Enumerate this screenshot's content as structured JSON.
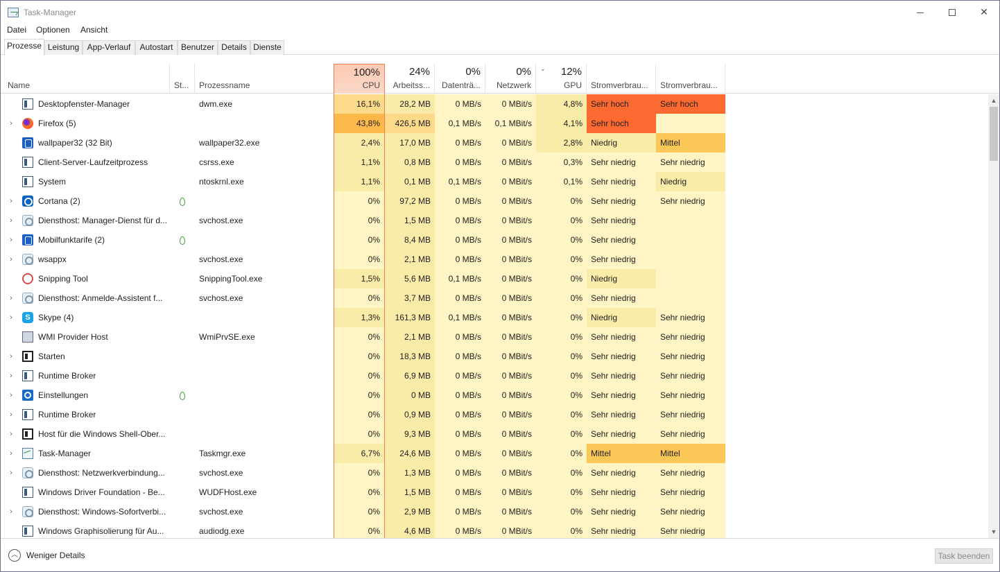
{
  "window": {
    "title": "Task-Manager",
    "minimize_glyph": "",
    "close_glyph": "✕"
  },
  "menu": [
    "Datei",
    "Optionen",
    "Ansicht"
  ],
  "tabs": [
    "Prozesse",
    "Leistung",
    "App-Verlauf",
    "Autostart",
    "Benutzer",
    "Details",
    "Dienste"
  ],
  "active_tab": "Prozesse",
  "columns": {
    "name": "Name",
    "status": "St...",
    "process": "Prozessname",
    "cpu": {
      "pct": "100%",
      "label": "CPU"
    },
    "memory": {
      "pct": "24%",
      "label": "Arbeitss..."
    },
    "disk": {
      "pct": "0%",
      "label": "Datenträ..."
    },
    "network": {
      "pct": "0%",
      "label": "Netzwerk"
    },
    "gpu": {
      "pct": "12%",
      "label": "GPU"
    },
    "power": "Stromverbrau...",
    "power_trend": "Stromverbrau...",
    "sort_glyph": "⌄"
  },
  "colors": {
    "heat_light": "#fff4c4",
    "heat_mid": "#f9eca8",
    "heat_warm": "#fdd98a",
    "heat_orange": "#fdc866",
    "heat_cpu_high": "#fcb84a",
    "power_very_high": "#fc6a32",
    "power_medium": "#fbc858",
    "cpu_accent": "#f08050"
  },
  "rows": [
    {
      "expand": "",
      "icon": "window",
      "name": "Desktopfenster-Manager",
      "leaf": false,
      "process": "dwm.exe",
      "cpu": "16,1%",
      "mem": "28,2 MB",
      "disk": "0 MB/s",
      "net": "0 MBit/s",
      "gpu": "4,8%",
      "power": "Sehr hoch",
      "power_trend": "Sehr hoch",
      "cpu_lvl": "warm",
      "gpu_lvl": "mid",
      "pow_lvl": "very_high",
      "powt_lvl": "very_high"
    },
    {
      "expand": "›",
      "icon": "firefox",
      "name": "Firefox (5)",
      "leaf": false,
      "process": "",
      "cpu": "43,8%",
      "mem": "426,5 MB",
      "disk": "0,1 MB/s",
      "net": "0,1 MBit/s",
      "gpu": "4,1%",
      "power": "Sehr hoch",
      "power_trend": "",
      "cpu_lvl": "cpu_high",
      "gpu_lvl": "mid",
      "pow_lvl": "very_high",
      "powt_lvl": "light"
    },
    {
      "expand": "",
      "icon": "blue",
      "name": "wallpaper32 (32 Bit)",
      "leaf": false,
      "process": "wallpaper32.exe",
      "cpu": "2,4%",
      "mem": "17,0 MB",
      "disk": "0 MB/s",
      "net": "0 MBit/s",
      "gpu": "2,8%",
      "power": "Niedrig",
      "power_trend": "Mittel",
      "cpu_lvl": "mid",
      "gpu_lvl": "mid",
      "pow_lvl": "mid",
      "powt_lvl": "medium"
    },
    {
      "expand": "",
      "icon": "window",
      "name": "Client-Server-Laufzeitprozess",
      "leaf": false,
      "process": "csrss.exe",
      "cpu": "1,1%",
      "mem": "0,8 MB",
      "disk": "0 MB/s",
      "net": "0 MBit/s",
      "gpu": "0,3%",
      "power": "Sehr niedrig",
      "power_trend": "Sehr niedrig",
      "cpu_lvl": "mid",
      "gpu_lvl": "light",
      "pow_lvl": "light",
      "powt_lvl": "light"
    },
    {
      "expand": "",
      "icon": "window",
      "name": "System",
      "leaf": false,
      "process": "ntoskrnl.exe",
      "cpu": "1,1%",
      "mem": "0,1 MB",
      "disk": "0,1 MB/s",
      "net": "0 MBit/s",
      "gpu": "0,1%",
      "power": "Sehr niedrig",
      "power_trend": "Niedrig",
      "cpu_lvl": "mid",
      "gpu_lvl": "light",
      "pow_lvl": "light",
      "powt_lvl": "mid"
    },
    {
      "expand": "›",
      "icon": "cortana",
      "name": "Cortana (2)",
      "leaf": true,
      "process": "",
      "cpu": "0%",
      "mem": "97,2 MB",
      "disk": "0 MB/s",
      "net": "0 MBit/s",
      "gpu": "0%",
      "power": "Sehr niedrig",
      "power_trend": "Sehr niedrig",
      "cpu_lvl": "light",
      "gpu_lvl": "light",
      "pow_lvl": "light",
      "powt_lvl": "light"
    },
    {
      "expand": "›",
      "icon": "gear",
      "name": "Diensthost: Manager-Dienst für d...",
      "leaf": false,
      "process": "svchost.exe",
      "cpu": "0%",
      "mem": "1,5 MB",
      "disk": "0 MB/s",
      "net": "0 MBit/s",
      "gpu": "0%",
      "power": "Sehr niedrig",
      "power_trend": "",
      "cpu_lvl": "light",
      "gpu_lvl": "light",
      "pow_lvl": "light",
      "powt_lvl": "light"
    },
    {
      "expand": "›",
      "icon": "blue",
      "name": "Mobilfunktarife (2)",
      "leaf": true,
      "process": "",
      "cpu": "0%",
      "mem": "8,4 MB",
      "disk": "0 MB/s",
      "net": "0 MBit/s",
      "gpu": "0%",
      "power": "Sehr niedrig",
      "power_trend": "",
      "cpu_lvl": "light",
      "gpu_lvl": "light",
      "pow_lvl": "light",
      "powt_lvl": "light"
    },
    {
      "expand": "›",
      "icon": "gear",
      "name": "wsappx",
      "leaf": false,
      "process": "svchost.exe",
      "cpu": "0%",
      "mem": "2,1 MB",
      "disk": "0 MB/s",
      "net": "0 MBit/s",
      "gpu": "0%",
      "power": "Sehr niedrig",
      "power_trend": "",
      "cpu_lvl": "light",
      "gpu_lvl": "light",
      "pow_lvl": "light",
      "powt_lvl": "light"
    },
    {
      "expand": "",
      "icon": "snip",
      "name": "Snipping Tool",
      "leaf": false,
      "process": "SnippingTool.exe",
      "cpu": "1,5%",
      "mem": "5,6 MB",
      "disk": "0,1 MB/s",
      "net": "0 MBit/s",
      "gpu": "0%",
      "power": "Niedrig",
      "power_trend": "",
      "cpu_lvl": "mid",
      "gpu_lvl": "light",
      "pow_lvl": "mid",
      "powt_lvl": "light"
    },
    {
      "expand": "›",
      "icon": "gear",
      "name": "Diensthost: Anmelde-Assistent f...",
      "leaf": false,
      "process": "svchost.exe",
      "cpu": "0%",
      "mem": "3,7 MB",
      "disk": "0 MB/s",
      "net": "0 MBit/s",
      "gpu": "0%",
      "power": "Sehr niedrig",
      "power_trend": "",
      "cpu_lvl": "light",
      "gpu_lvl": "light",
      "pow_lvl": "light",
      "powt_lvl": "light"
    },
    {
      "expand": "›",
      "icon": "skype",
      "name": "Skype (4)",
      "leaf": false,
      "process": "",
      "cpu": "1,3%",
      "mem": "161,3 MB",
      "disk": "0,1 MB/s",
      "net": "0 MBit/s",
      "gpu": "0%",
      "power": "Niedrig",
      "power_trend": "Sehr niedrig",
      "cpu_lvl": "mid",
      "gpu_lvl": "light",
      "pow_lvl": "mid",
      "powt_lvl": "light"
    },
    {
      "expand": "",
      "icon": "wmi",
      "name": "WMI Provider Host",
      "leaf": false,
      "process": "WmiPrvSE.exe",
      "cpu": "0%",
      "mem": "2,1 MB",
      "disk": "0 MB/s",
      "net": "0 MBit/s",
      "gpu": "0%",
      "power": "Sehr niedrig",
      "power_trend": "Sehr niedrig",
      "cpu_lvl": "light",
      "gpu_lvl": "light",
      "pow_lvl": "light",
      "powt_lvl": "light"
    },
    {
      "expand": "›",
      "icon": "dark",
      "name": "Starten",
      "leaf": false,
      "process": "",
      "cpu": "0%",
      "mem": "18,3 MB",
      "disk": "0 MB/s",
      "net": "0 MBit/s",
      "gpu": "0%",
      "power": "Sehr niedrig",
      "power_trend": "Sehr niedrig",
      "cpu_lvl": "light",
      "gpu_lvl": "light",
      "pow_lvl": "light",
      "powt_lvl": "light"
    },
    {
      "expand": "›",
      "icon": "window",
      "name": "Runtime Broker",
      "leaf": false,
      "process": "",
      "cpu": "0%",
      "mem": "6,9 MB",
      "disk": "0 MB/s",
      "net": "0 MBit/s",
      "gpu": "0%",
      "power": "Sehr niedrig",
      "power_trend": "Sehr niedrig",
      "cpu_lvl": "light",
      "gpu_lvl": "light",
      "pow_lvl": "light",
      "powt_lvl": "light"
    },
    {
      "expand": "›",
      "icon": "settings",
      "name": "Einstellungen",
      "leaf": true,
      "process": "",
      "cpu": "0%",
      "mem": "0 MB",
      "disk": "0 MB/s",
      "net": "0 MBit/s",
      "gpu": "0%",
      "power": "Sehr niedrig",
      "power_trend": "Sehr niedrig",
      "cpu_lvl": "light",
      "gpu_lvl": "light",
      "pow_lvl": "light",
      "powt_lvl": "light"
    },
    {
      "expand": "›",
      "icon": "window",
      "name": "Runtime Broker",
      "leaf": false,
      "process": "",
      "cpu": "0%",
      "mem": "0,9 MB",
      "disk": "0 MB/s",
      "net": "0 MBit/s",
      "gpu": "0%",
      "power": "Sehr niedrig",
      "power_trend": "Sehr niedrig",
      "cpu_lvl": "light",
      "gpu_lvl": "light",
      "pow_lvl": "light",
      "powt_lvl": "light"
    },
    {
      "expand": "›",
      "icon": "dark",
      "name": "Host für die Windows Shell-Ober...",
      "leaf": false,
      "process": "",
      "cpu": "0%",
      "mem": "9,3 MB",
      "disk": "0 MB/s",
      "net": "0 MBit/s",
      "gpu": "0%",
      "power": "Sehr niedrig",
      "power_trend": "Sehr niedrig",
      "cpu_lvl": "light",
      "gpu_lvl": "light",
      "pow_lvl": "light",
      "powt_lvl": "light"
    },
    {
      "expand": "›",
      "icon": "tm",
      "name": "Task-Manager",
      "leaf": false,
      "process": "Taskmgr.exe",
      "cpu": "6,7%",
      "mem": "24,6 MB",
      "disk": "0 MB/s",
      "net": "0 MBit/s",
      "gpu": "0%",
      "power": "Mittel",
      "power_trend": "Mittel",
      "cpu_lvl": "mid",
      "gpu_lvl": "light",
      "pow_lvl": "medium",
      "powt_lvl": "medium"
    },
    {
      "expand": "›",
      "icon": "gear",
      "name": "Diensthost: Netzwerkverbindung...",
      "leaf": false,
      "process": "svchost.exe",
      "cpu": "0%",
      "mem": "1,3 MB",
      "disk": "0 MB/s",
      "net": "0 MBit/s",
      "gpu": "0%",
      "power": "Sehr niedrig",
      "power_trend": "Sehr niedrig",
      "cpu_lvl": "light",
      "gpu_lvl": "light",
      "pow_lvl": "light",
      "powt_lvl": "light"
    },
    {
      "expand": "",
      "icon": "window",
      "name": "Windows Driver Foundation - Be...",
      "leaf": false,
      "process": "WUDFHost.exe",
      "cpu": "0%",
      "mem": "1,5 MB",
      "disk": "0 MB/s",
      "net": "0 MBit/s",
      "gpu": "0%",
      "power": "Sehr niedrig",
      "power_trend": "Sehr niedrig",
      "cpu_lvl": "light",
      "gpu_lvl": "light",
      "pow_lvl": "light",
      "powt_lvl": "light"
    },
    {
      "expand": "›",
      "icon": "gear",
      "name": "Diensthost: Windows-Sofortverbi...",
      "leaf": false,
      "process": "svchost.exe",
      "cpu": "0%",
      "mem": "2,9 MB",
      "disk": "0 MB/s",
      "net": "0 MBit/s",
      "gpu": "0%",
      "power": "Sehr niedrig",
      "power_trend": "Sehr niedrig",
      "cpu_lvl": "light",
      "gpu_lvl": "light",
      "pow_lvl": "light",
      "powt_lvl": "light"
    },
    {
      "expand": "",
      "icon": "window",
      "name": "Windows Graphisolierung für Au...",
      "leaf": false,
      "process": "audiodg.exe",
      "cpu": "0%",
      "mem": "4,6 MB",
      "disk": "0 MB/s",
      "net": "0 MBit/s",
      "gpu": "0%",
      "power": "Sehr niedrig",
      "power_trend": "Sehr niedrig",
      "cpu_lvl": "light",
      "gpu_lvl": "light",
      "pow_lvl": "light",
      "powt_lvl": "light"
    }
  ],
  "footer": {
    "fewer_details": "Weniger Details",
    "fewer_glyph": "︿",
    "end_task": "Task beenden"
  }
}
